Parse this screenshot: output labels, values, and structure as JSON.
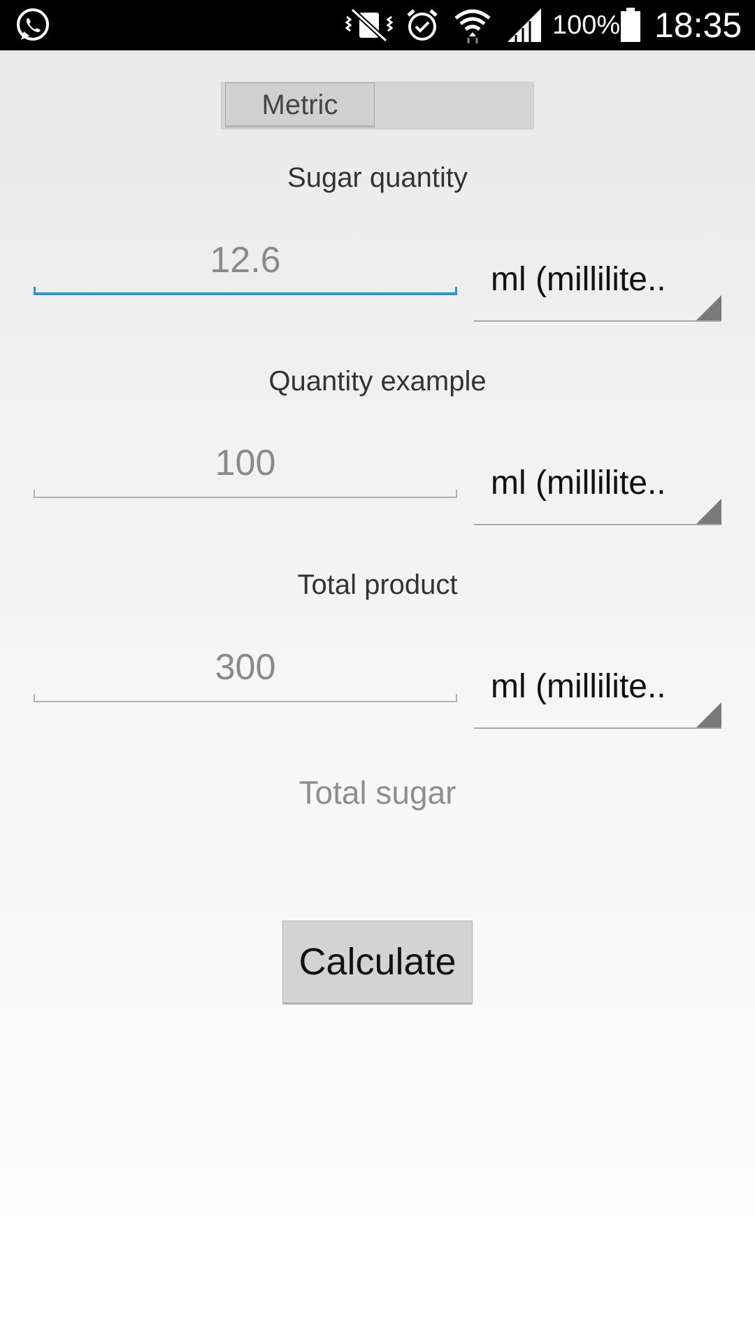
{
  "status_bar": {
    "battery_percent": "100%",
    "time": "18:35",
    "icons": [
      "whatsapp-icon",
      "mute-vibrate-icon",
      "alarm-icon",
      "wifi-icon",
      "signal-icon",
      "battery-icon"
    ]
  },
  "unit_toggle": {
    "label": "Metric"
  },
  "sugar_quantity": {
    "label": "Sugar quantity",
    "value": "12.6",
    "unit": "ml (millilite.."
  },
  "quantity_example": {
    "label": "Quantity example",
    "value": "100",
    "unit": "ml (millilite.."
  },
  "total_product": {
    "label": "Total product",
    "value": "300",
    "unit": "ml (millilite.."
  },
  "result": {
    "label": "Total sugar"
  },
  "calculate_button": {
    "label": "Calculate"
  },
  "colors": {
    "accent": "#1e9bd6",
    "status_bar": "#000000"
  }
}
